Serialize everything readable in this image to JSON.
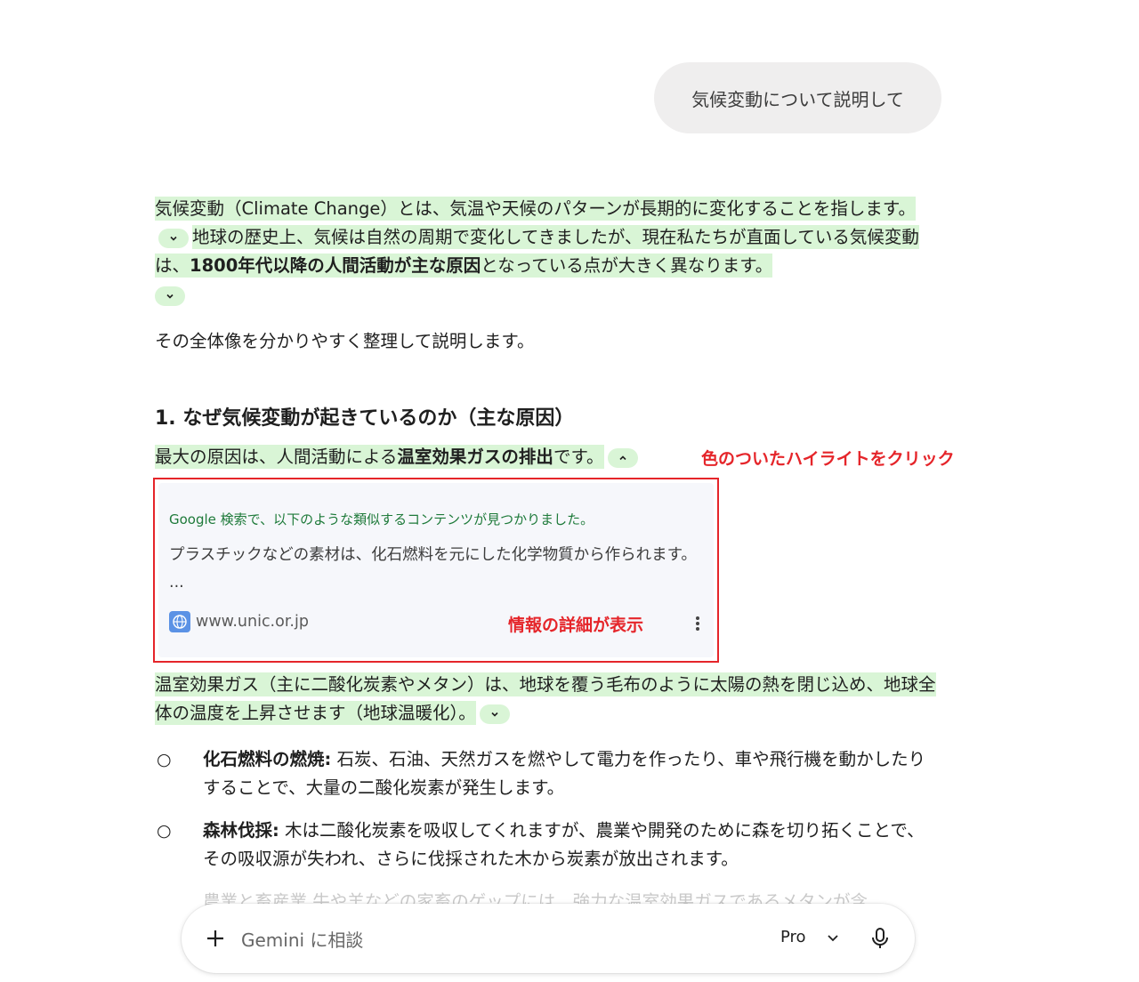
{
  "user_message": "気候変動について説明して",
  "intro": {
    "p1_hl1": "気候変動（Climate Change）とは、気温や天候のパターンが長期的に変化することを指します。",
    "p1_hl2a": "地球の歴史上、気候は自然の周期で変化してきましたが、現在私たちが直面している気候変動は、",
    "p1_hl2b": "1800年代以降の人間活動が主な原因",
    "p1_hl2c": "となっている点が大きく異なります。",
    "p2": "その全体像を分かりやすく整理して説明します。"
  },
  "section1": {
    "heading": "1. なぜ気候変動が起きているのか（主な原因）",
    "sentence_a": "最大の原因は、人間活動による",
    "sentence_b": "温室効果ガスの排出",
    "sentence_c": "です。",
    "annotation_click": "色のついたハイライトをクリック",
    "source_card": {
      "header": "Google 検索で、以下のような類似するコンテンツが見つかりました。",
      "body": "プラスチックなどの素材は、化石燃料を元にした化学物質から作られます。 ...",
      "domain": "www.unic.or.jp",
      "annotation_detail": "情報の詳細が表示"
    },
    "greenhouse": "温室効果ガス（主に二酸化炭素やメタン）は、地球を覆う毛布のように太陽の熱を閉じ込め、地球全体の温度を上昇させます（地球温暖化）。",
    "bullets": [
      {
        "mark": "○",
        "title": "化石燃料の燃焼:",
        "text": " 石炭、石油、天然ガスを燃やして電力を作ったり、車や飛行機を動かしたりすることで、大量の二酸化炭素が発生します。"
      },
      {
        "mark": "○",
        "title": "森林伐採:",
        "text": " 木は二酸化炭素を吸収してくれますが、農業や開発のために森を切り拓くことで、その吸収源が失われ、さらに伐採された木から炭素が放出されます。"
      }
    ],
    "faded_line": "農業と畜産業 牛や羊などの家畜のゲップには、強力な温室効果ガスであるメタンが含"
  },
  "input_bar": {
    "placeholder": "Gemini に相談",
    "model": "Pro"
  },
  "colors": {
    "highlight": "#d9f5d6",
    "annotation": "#e5252a",
    "source_header": "#1e7a3a"
  }
}
